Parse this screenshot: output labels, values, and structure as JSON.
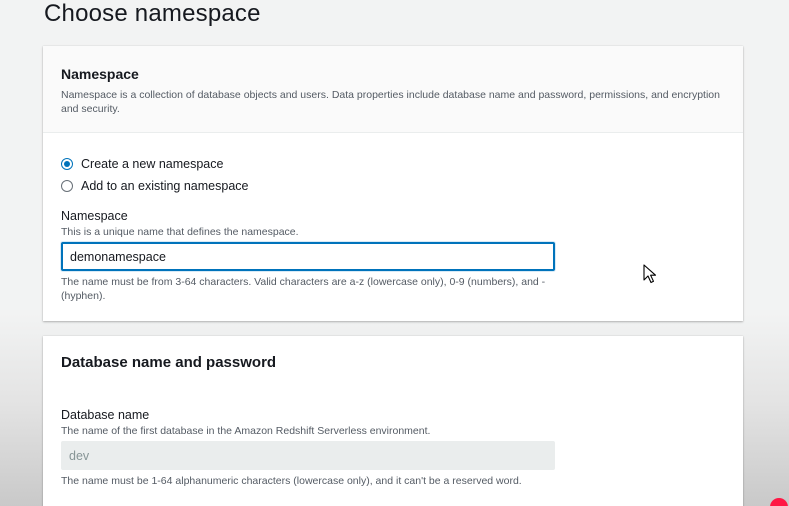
{
  "page": {
    "title": "Choose namespace"
  },
  "namespace_panel": {
    "title": "Namespace",
    "description": "Namespace is a collection of database objects and users. Data properties include database name and password, permissions, and encryption and security.",
    "options": [
      {
        "label": "Create a new namespace",
        "selected": true
      },
      {
        "label": "Add to an existing namespace",
        "selected": false
      }
    ],
    "field": {
      "label": "Namespace",
      "description": "This is a unique name that defines the namespace.",
      "value": "demonamespace",
      "constraint": "The name must be from 3-64 characters. Valid characters are a-z (lowercase only), 0-9 (numbers), and - (hyphen)."
    }
  },
  "database_panel": {
    "title": "Database name and password",
    "field": {
      "label": "Database name",
      "description": "The name of the first database in the Amazon Redshift Serverless environment.",
      "value": "dev",
      "constraint": "The name must be 1-64 alphanumeric characters (lowercase only), and it can't be a reserved word."
    }
  },
  "colors": {
    "accent": "#0073bb",
    "background": "#f2f3f3",
    "text": "#16191f",
    "secondary_text": "#545b64"
  },
  "icons": {
    "cursor": "mouse-pointer-icon",
    "recording": "recording-indicator-icon"
  }
}
